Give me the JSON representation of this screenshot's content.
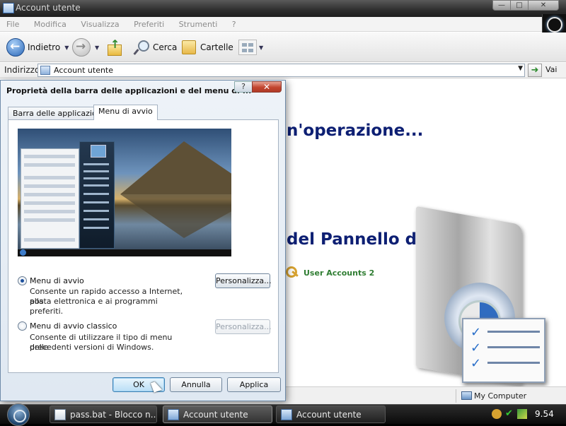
{
  "explorer": {
    "title": "Account utente",
    "window_buttons": {
      "minimize": "—",
      "maximize": "□",
      "close": "✕"
    },
    "menu": [
      "File",
      "Modifica",
      "Visualizza",
      "Preferiti",
      "Strumenti",
      "?"
    ],
    "toolbar": {
      "back": "Indietro",
      "search": "Cerca",
      "folders": "Cartelle"
    },
    "address": {
      "label": "Indirizzo",
      "value": "Account utente",
      "go": "Vai"
    },
    "content": {
      "task_heading": "n'operazione...",
      "panel_heading": "del Pannello di controllo",
      "link": "User Accounts 2"
    },
    "status": {
      "location": "My Computer"
    }
  },
  "dialog": {
    "title": "Proprietà della barra delle applicazioni e del menu di ...",
    "help": "?",
    "close": "✕",
    "tabs": [
      "Barra delle applicazioni",
      "Menu di avvio"
    ],
    "active_tab": 1,
    "options": [
      {
        "label": "Menu di avvio",
        "selected": true,
        "line1": "Consente un rapido accesso a Internet, alla",
        "line2": "posta elettronica e ai programmi preferiti.",
        "button": "Personalizza...",
        "button_enabled": true
      },
      {
        "label": "Menu di avvio classico",
        "selected": false,
        "line1": "Consente di utilizzare il tipo di menu delle",
        "line2": "precedenti versioni di Windows.",
        "button": "Personalizza...",
        "button_enabled": false
      }
    ],
    "buttons": {
      "ok": "OK",
      "cancel": "Annulla",
      "apply": "Applica"
    }
  },
  "taskbar": {
    "items": [
      {
        "label": "pass.bat - Blocco n...",
        "icon": "notepad-icon",
        "active": false
      },
      {
        "label": "Account utente",
        "icon": "explorer-window-icon",
        "active": true
      },
      {
        "label": "Account utente",
        "icon": "user-accounts-icon",
        "active": false
      }
    ],
    "clock": "9.54"
  }
}
